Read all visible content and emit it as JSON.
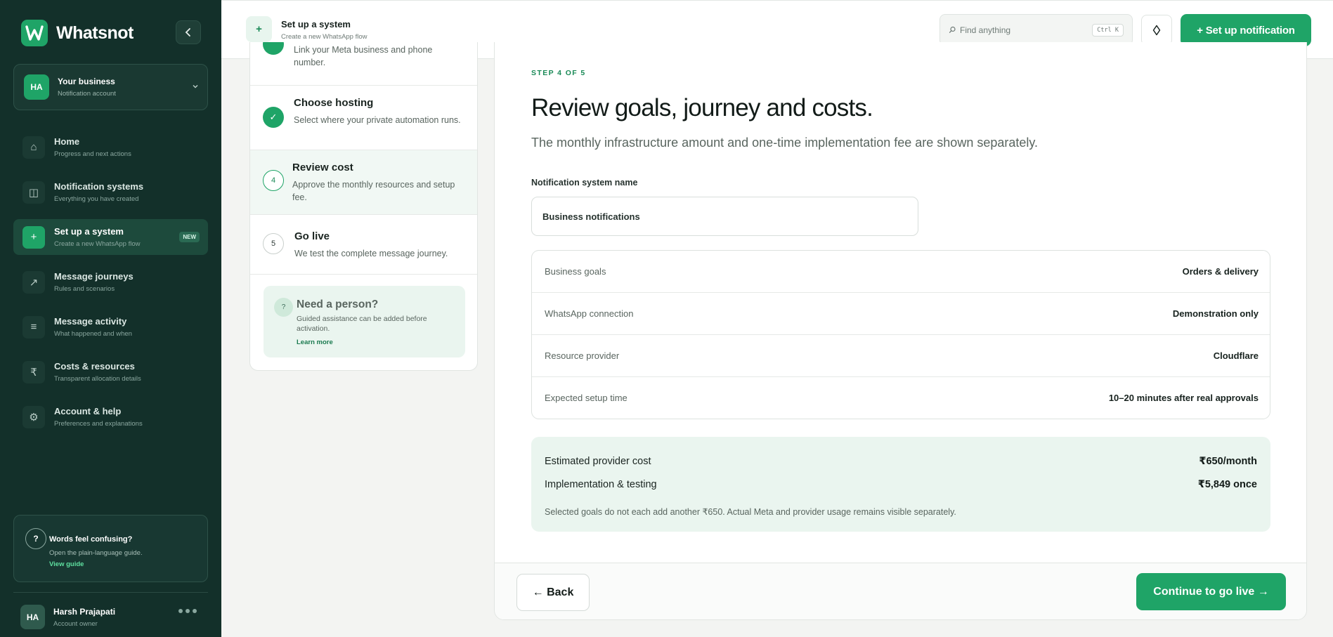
{
  "brand": {
    "name": "Whatsnot",
    "logo_letter": "W"
  },
  "account": {
    "initials": "HA",
    "title": "Your business",
    "subtitle": "Notification account"
  },
  "nav": {
    "items": [
      {
        "label": "Home",
        "sub": "Progress and next actions",
        "icon": "home-icon",
        "glyph": "⌂"
      },
      {
        "label": "Notification systems",
        "sub": "Everything you have created",
        "icon": "panels-icon",
        "glyph": "◫"
      },
      {
        "label": "Set up a system",
        "sub": "Create a new WhatsApp flow",
        "icon": "plus-icon",
        "glyph": "+",
        "badge": "NEW",
        "active": true
      },
      {
        "label": "Message journeys",
        "sub": "Rules and scenarios",
        "icon": "arrow-up-right-icon",
        "glyph": "↗"
      },
      {
        "label": "Message activity",
        "sub": "What happened and when",
        "icon": "list-icon",
        "glyph": "≡"
      },
      {
        "label": "Costs & resources",
        "sub": "Transparent allocation details",
        "icon": "rupee-icon",
        "glyph": "₹"
      },
      {
        "label": "Account & help",
        "sub": "Preferences and explanations",
        "icon": "gear-icon",
        "glyph": "⚙"
      }
    ]
  },
  "help_card": {
    "glyph": "?",
    "title": "Words feel confusing?",
    "subtitle": "Open the plain-language guide.",
    "link": "View guide"
  },
  "user": {
    "initials": "HA",
    "name": "Harsh Prajapati",
    "role": "Account owner"
  },
  "topbar": {
    "glyph": "+",
    "title": "Set up a system",
    "subtitle": "Create a new WhatsApp flow",
    "search_placeholder": "Find anything",
    "search_shortcut": "Ctrl K",
    "cta": "+ Set up notification"
  },
  "steps": {
    "items": [
      {
        "title": "",
        "desc": "Link your Meta business and phone number.",
        "state": "done"
      },
      {
        "title": "Choose hosting",
        "desc": "Select where your private automation runs.",
        "state": "done",
        "glyph": "✓"
      },
      {
        "title": "Review cost",
        "desc": "Approve the monthly resources and setup fee.",
        "state": "current",
        "number": "4"
      },
      {
        "title": "Go live",
        "desc": "We test the complete message journey.",
        "state": "todo",
        "number": "5"
      }
    ],
    "need_help": {
      "glyph": "?",
      "title": "Need a person?",
      "desc": "Guided assistance can be added before activation.",
      "link": "Learn more"
    }
  },
  "main": {
    "eyebrow": "STEP 4 OF 5",
    "heading": "Review goals, journey and costs.",
    "lede": "The monthly infrastructure amount and one-time implementation fee are shown separately.",
    "name_label": "Notification system name",
    "name_value": "Business notifications",
    "summary": [
      {
        "label": "Business goals",
        "value": "Orders & delivery"
      },
      {
        "label": "WhatsApp connection",
        "value": "Demonstration only"
      },
      {
        "label": "Resource provider",
        "value": "Cloudflare"
      },
      {
        "label": "Expected setup time",
        "value": "10–20 minutes after real approvals"
      }
    ],
    "costs": [
      {
        "label": "Estimated provider cost",
        "value": "₹650/month"
      },
      {
        "label": "Implementation & testing",
        "value": "₹5,849 once"
      }
    ],
    "cost_note": "Selected goals do not each add another ₹650. Actual Meta and provider usage remains visible separately.",
    "back": "← Back",
    "next": "Continue to go live →"
  },
  "colors": {
    "accent": "#1fa467",
    "sidebar": "#13302a",
    "accent_soft": "#eaf5ef"
  }
}
